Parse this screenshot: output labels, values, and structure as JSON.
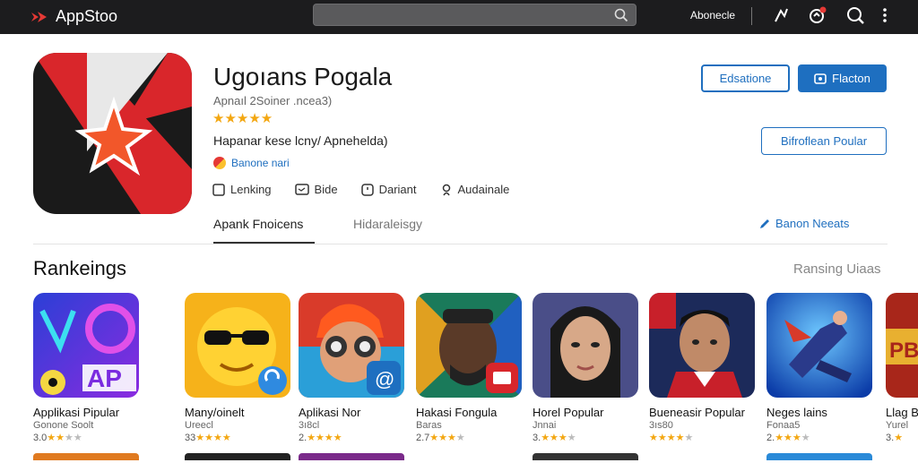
{
  "topbar": {
    "app_name": "AppStoo",
    "search_placeholder": "",
    "user_label": "Abonecle"
  },
  "app": {
    "title": "Ugoıans Pogala",
    "subtitle": "Apnaıl 2Soiner .ncea3)",
    "rating_stars": "★★★★★",
    "description": "Hapanar kese lcny/ Apnehelda)",
    "developer": "Banone nari",
    "features": [
      {
        "icon": "checkbox-icon",
        "label": "Lenking"
      },
      {
        "icon": "chat-icon",
        "label": "Bide"
      },
      {
        "icon": "info-icon",
        "label": "Dariant"
      },
      {
        "icon": "location-icon",
        "label": "Audainale"
      }
    ],
    "secondary_button": "Edsatione",
    "install_button": "Flacton",
    "wishlist_button": "Bifroflean Poular"
  },
  "tabs": {
    "items": [
      {
        "label": "Apank Fnoicens"
      },
      {
        "label": "Hidaraleisgy"
      }
    ],
    "nav_link": "Banon Neeats"
  },
  "rankings": {
    "title": "Rankeings",
    "see_all": "Ransing Uiaas",
    "apps": [
      {
        "name": "Applikasi Pipular",
        "sub": "Gonone Soolt",
        "rating_num": "3.0",
        "stars_filled": "★★",
        "stars_empty": "★★"
      },
      {
        "name": "Many/oinelt",
        "sub": "Ureecl",
        "rating_num": "33",
        "stars_filled": "★★★★",
        "stars_empty": ""
      },
      {
        "name": "Aplikasi Nor",
        "sub": "3ı8cl",
        "rating_num": "2.",
        "stars_filled": "★★★★",
        "stars_empty": ""
      },
      {
        "name": "Hakasi Fongula",
        "sub": "Baras",
        "rating_num": "2.7",
        "stars_filled": "★★★",
        "stars_empty": "★"
      },
      {
        "name": "Horel Popular",
        "sub": "Jnnai",
        "rating_num": "3.",
        "stars_filled": "★★★",
        "stars_empty": "★"
      },
      {
        "name": "Bueneasir Popular",
        "sub": "3ıs80",
        "rating_num": "",
        "stars_filled": "★★★★",
        "stars_empty": "★"
      },
      {
        "name": "Neges lains",
        "sub": "Fonaa5",
        "rating_num": "2.",
        "stars_filled": "★★★",
        "stars_empty": "★"
      },
      {
        "name": "Llag B",
        "sub": "Yurel",
        "rating_num": "3.",
        "stars_filled": "★",
        "stars_empty": ""
      }
    ]
  },
  "colors": {
    "accent": "#1e6fc0",
    "topbar": "#1c1c1e",
    "star": "#f3a712"
  }
}
